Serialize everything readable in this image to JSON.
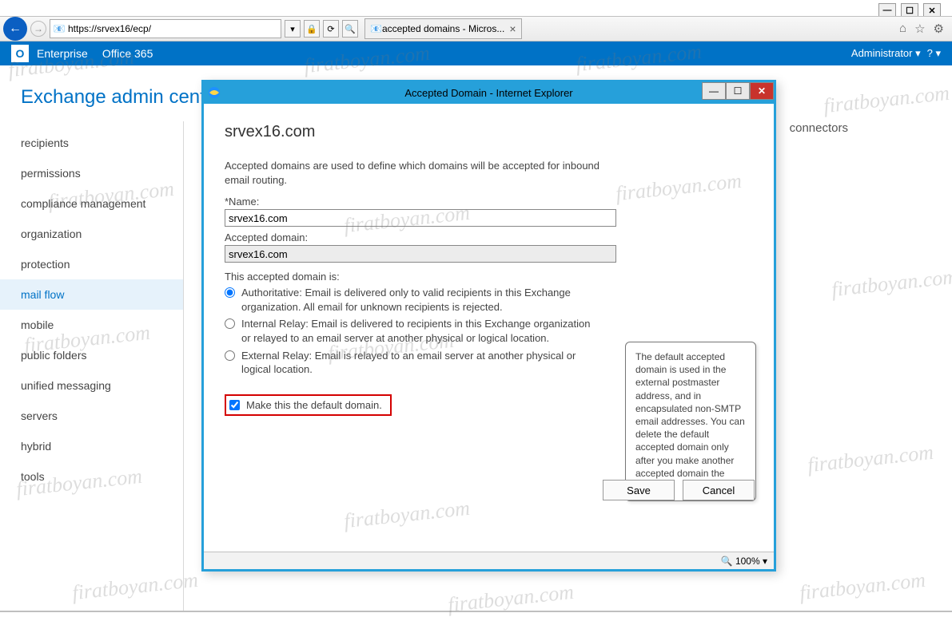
{
  "window": {
    "min": "—",
    "max": "☐",
    "close": "✕"
  },
  "ie": {
    "back": "←",
    "fwd": "→",
    "url": "https://srvex16/ecp/",
    "lock": "🔒",
    "refresh": "⟳",
    "search": "🔍",
    "tab_title": "accepted domains - Micros...",
    "tab_close": "×",
    "nav_home": "⌂",
    "nav_star": "☆",
    "nav_gear": "⚙"
  },
  "exbar": {
    "logo": "O",
    "enterprise": "Enterprise",
    "office365": "Office 365",
    "admin": "Administrator ▾",
    "help": "? ▾"
  },
  "page": {
    "title": "Exchange admin center",
    "connectors": "connectors"
  },
  "sidebar": [
    {
      "label": "recipients"
    },
    {
      "label": "permissions"
    },
    {
      "label": "compliance management"
    },
    {
      "label": "organization"
    },
    {
      "label": "protection"
    },
    {
      "label": "mail flow"
    },
    {
      "label": "mobile"
    },
    {
      "label": "public folders"
    },
    {
      "label": "unified messaging"
    },
    {
      "label": "servers"
    },
    {
      "label": "hybrid"
    },
    {
      "label": "tools"
    }
  ],
  "sidebar_active_index": 5,
  "modal": {
    "title": "Accepted Domain - Internet Explorer",
    "heading": "srvex16.com",
    "desc": "Accepted domains are used to define which domains will be accepted for inbound email routing.",
    "name_label": "*Name:",
    "name_value": "srvex16.com",
    "domain_label": "Accepted domain:",
    "domain_value": "srvex16.com",
    "type_label": "This accepted domain is:",
    "radio1": "Authoritative: Email is delivered only to valid recipients in this Exchange organization. All email for unknown recipients is rejected.",
    "radio2": "Internal Relay: Email is delivered to recipients in this Exchange organization or relayed to an email server at another physical or logical location.",
    "radio3": "External Relay: Email is relayed to an email server at another physical or logical location.",
    "default_label": "Make this the default domain.",
    "tooltip": "The default accepted domain is used in the external postmaster address, and in encapsulated non-SMTP email addresses. You can delete the default accepted domain only after you make another accepted domain the default.",
    "save": "Save",
    "cancel": "Cancel",
    "zoom": "🔍 100%  ▾",
    "min": "—",
    "max": "☐",
    "close": "✕"
  },
  "watermark": "firatboyan.com"
}
